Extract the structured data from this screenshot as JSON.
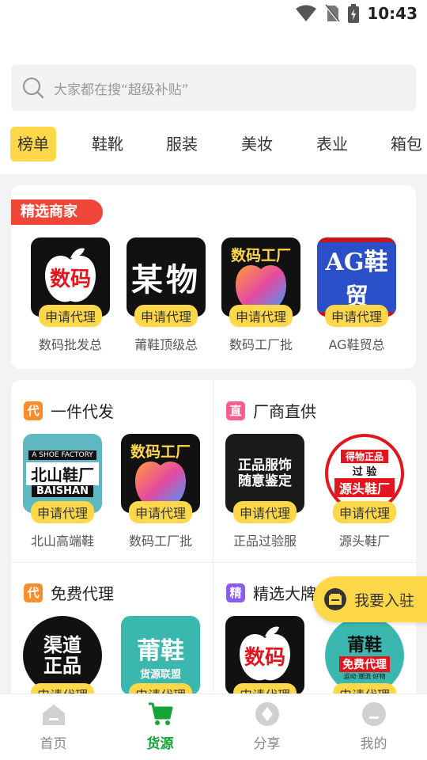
{
  "status": {
    "time": "10:43"
  },
  "search": {
    "placeholder": "大家都在搜“超级补贴”"
  },
  "tabs": [
    "榜单",
    "鞋靴",
    "服装",
    "美妆",
    "表业",
    "箱包"
  ],
  "featured": {
    "banner": "精选商家",
    "merchants": [
      {
        "logo_text": "数码",
        "agent": "申请代理",
        "name": "数码批发总"
      },
      {
        "logo_text": "某物",
        "agent": "申请代理",
        "name": "莆鞋顶级总"
      },
      {
        "logo_text": "数码工厂",
        "agent": "申请代理",
        "name": "数码工厂批"
      },
      {
        "logo_text": "AG鞋贸",
        "agent": "申请代理",
        "name": "AG鞋贸总"
      }
    ]
  },
  "sections": [
    {
      "tag": "代",
      "tag_color": "#ff8c2a",
      "title": "一件代发",
      "items": [
        {
          "logo_text": "北山鞋厂",
          "logo_sub": "A SHOE FACTORY",
          "logo_en": "BAISHAN",
          "agent": "申请代理",
          "name": "北山高端鞋"
        },
        {
          "logo_text": "数码工厂",
          "agent": "申请代理",
          "name": "数码工厂批"
        }
      ]
    },
    {
      "tag": "直",
      "tag_color": "#ff5e8a",
      "title": "厂商直供",
      "items": [
        {
          "logo_text": "正品服饰 随意鉴定",
          "agent": "申请代理",
          "name": "正品过验服"
        },
        {
          "logo_text": "源头鞋厂",
          "logo_sub": "得物正品",
          "logo_mid": "过 验",
          "agent": "申请代理",
          "name": "源头鞋厂"
        }
      ]
    },
    {
      "tag": "代",
      "tag_color": "#ff8c2a",
      "title": "免费代理",
      "items": [
        {
          "logo_text": "渠道正品",
          "agent": "申请代理",
          "name": ""
        },
        {
          "logo_text": "莆鞋",
          "logo_sub": "货源联盟",
          "agent": "申请代理",
          "name": ""
        }
      ]
    },
    {
      "tag": "精",
      "tag_color": "#8a5cf0",
      "title": "精选大牌",
      "items": [
        {
          "logo_text": "数码",
          "agent": "申请代理",
          "name": ""
        },
        {
          "logo_text": "莆鞋",
          "logo_sub": "免费代理",
          "logo_mid": "运动·潮流·好物",
          "agent": "申请代理",
          "name": ""
        }
      ]
    }
  ],
  "join": {
    "label": "我要入驻"
  },
  "nav": [
    {
      "label": "首页",
      "icon": "home-icon"
    },
    {
      "label": "货源",
      "icon": "cart-icon"
    },
    {
      "label": "分享",
      "icon": "share-icon"
    },
    {
      "label": "我的",
      "icon": "profile-icon"
    }
  ],
  "colors": {
    "accent": "#ffd84a",
    "active_nav": "#13a538",
    "banner": "#f04637"
  }
}
